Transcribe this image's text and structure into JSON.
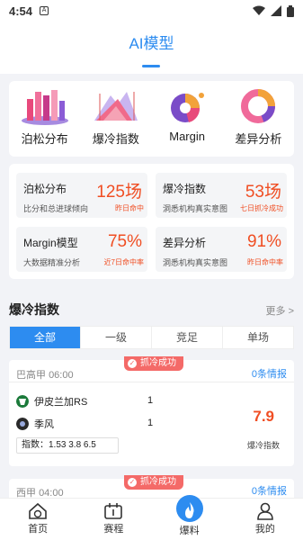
{
  "status_bar": {
    "time": "4:54",
    "notif": "A"
  },
  "header": {
    "title": "AI模型"
  },
  "models": [
    {
      "label": "泊松分布",
      "icon": "poisson-bars-icon"
    },
    {
      "label": "爆冷指数",
      "icon": "cold-index-chart-icon"
    },
    {
      "label": "Margin",
      "icon": "margin-pie-icon"
    },
    {
      "label": "差异分析",
      "icon": "difference-ring-icon"
    }
  ],
  "stats": [
    {
      "name": "泊松分布",
      "value": "125场",
      "desc": "比分和总进球倾向",
      "rate": "昨日命中"
    },
    {
      "name": "爆冷指数",
      "value": "53场",
      "desc": "洞悉机构真实意图",
      "rate": "七日抓冷成功"
    },
    {
      "name": "Margin模型",
      "value": "75%",
      "desc": "大数据精准分析",
      "rate": "近7日命中率"
    },
    {
      "name": "差异分析",
      "value": "91%",
      "desc": "洞悉机构真实意图",
      "rate": "昨日命中率"
    }
  ],
  "section": {
    "title": "爆冷指数",
    "more": "更多 >"
  },
  "tabs": [
    "全部",
    "一级",
    "竞足",
    "单场"
  ],
  "matches": [
    {
      "league": "巴高甲",
      "time": "06:00",
      "badge": "抓冷成功",
      "info": "0条情报",
      "home": "伊皮兰加RS",
      "away": "季风",
      "home_score": "1",
      "away_score": "1",
      "index_label": "指数：",
      "index_values": "1.53 3.8 6.5",
      "cold_value": "7.9",
      "cold_label": "爆冷指数"
    },
    {
      "league": "西甲",
      "time": "04:00",
      "badge": "抓冷成功",
      "info": "0条情报"
    }
  ],
  "tabbar": [
    {
      "label": "首页",
      "icon": "home-ball-icon"
    },
    {
      "label": "赛程",
      "icon": "schedule-icon"
    },
    {
      "label": "爆料",
      "icon": "fire-icon"
    },
    {
      "label": "我的",
      "icon": "user-icon"
    }
  ],
  "colors": {
    "accent": "#2d8cf0",
    "highlight": "#f04e23",
    "badge": "#f46a68"
  }
}
